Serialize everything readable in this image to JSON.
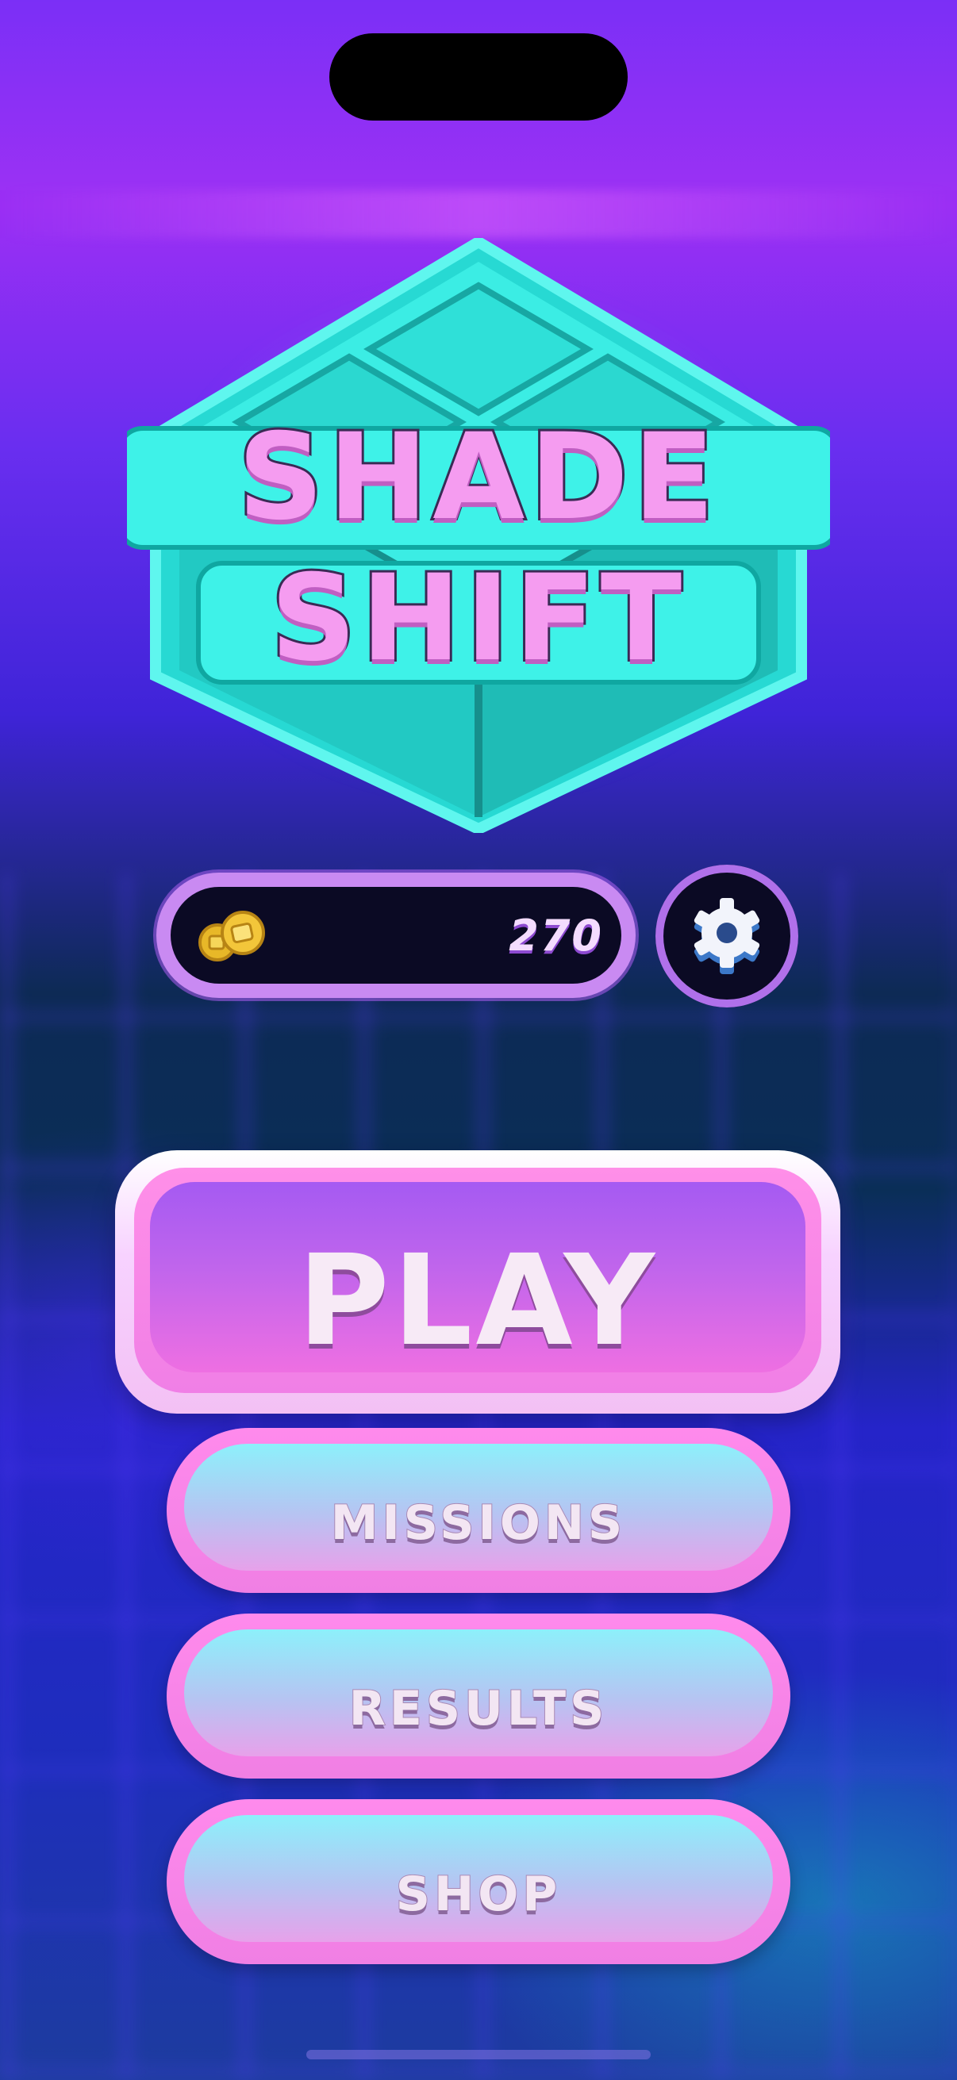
{
  "logo": {
    "line1": "SHADE",
    "line2": "SHIFT"
  },
  "currency": {
    "icon": "coins-icon",
    "amount": "270"
  },
  "settings": {
    "icon": "gear-icon"
  },
  "menu": {
    "play_label": "PLAY",
    "missions_label": "MISSIONS",
    "results_label": "RESULTS",
    "shop_label": "SHOP"
  },
  "colors": {
    "background_top": "#8a2cf2",
    "logo_cube": "#2de6dc",
    "logo_text": "#f59cf0",
    "play_button": "#c065ec",
    "menu_button_face": "#8df0fb",
    "menu_button_rim": "#ff8aec"
  }
}
